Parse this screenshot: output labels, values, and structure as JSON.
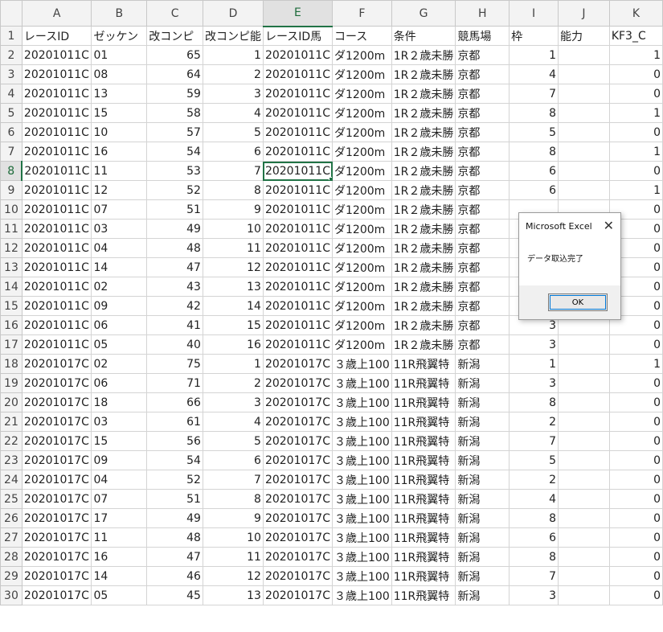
{
  "columns": [
    "A",
    "B",
    "C",
    "D",
    "E",
    "F",
    "G",
    "H",
    "I",
    "J",
    "K"
  ],
  "selected_column": "E",
  "selected_row": "8",
  "active_cell": "E8",
  "header_row": [
    "レースID",
    "ゼッケン",
    "改コンピ",
    "改コンピ能",
    "レースID馬",
    "コース",
    "条件",
    "競馬場",
    "枠",
    "能力",
    "KF3_C"
  ],
  "rows": [
    {
      "n": "2",
      "c": [
        "20201011C",
        "01",
        "65",
        "1",
        "20201011C",
        "ダ1200m",
        "1R２歳未勝",
        "京都",
        "1",
        "",
        "1"
      ]
    },
    {
      "n": "3",
      "c": [
        "20201011C",
        "08",
        "64",
        "2",
        "20201011C",
        "ダ1200m",
        "1R２歳未勝",
        "京都",
        "4",
        "",
        "0"
      ]
    },
    {
      "n": "4",
      "c": [
        "20201011C",
        "13",
        "59",
        "3",
        "20201011C",
        "ダ1200m",
        "1R２歳未勝",
        "京都",
        "7",
        "",
        "0"
      ]
    },
    {
      "n": "5",
      "c": [
        "20201011C",
        "15",
        "58",
        "4",
        "20201011C",
        "ダ1200m",
        "1R２歳未勝",
        "京都",
        "8",
        "",
        "1"
      ]
    },
    {
      "n": "6",
      "c": [
        "20201011C",
        "10",
        "57",
        "5",
        "20201011C",
        "ダ1200m",
        "1R２歳未勝",
        "京都",
        "5",
        "",
        "0"
      ]
    },
    {
      "n": "7",
      "c": [
        "20201011C",
        "16",
        "54",
        "6",
        "20201011C",
        "ダ1200m",
        "1R２歳未勝",
        "京都",
        "8",
        "",
        "1"
      ]
    },
    {
      "n": "8",
      "c": [
        "20201011C",
        "11",
        "53",
        "7",
        "20201011C",
        "ダ1200m",
        "1R２歳未勝",
        "京都",
        "6",
        "",
        "0"
      ]
    },
    {
      "n": "9",
      "c": [
        "20201011C",
        "12",
        "52",
        "8",
        "20201011C",
        "ダ1200m",
        "1R２歳未勝",
        "京都",
        "6",
        "",
        "1"
      ]
    },
    {
      "n": "10",
      "c": [
        "20201011C",
        "07",
        "51",
        "9",
        "20201011C",
        "ダ1200m",
        "1R２歳未勝",
        "京都",
        "",
        "",
        "0"
      ]
    },
    {
      "n": "11",
      "c": [
        "20201011C",
        "03",
        "49",
        "10",
        "20201011C",
        "ダ1200m",
        "1R２歳未勝",
        "京都",
        "",
        "",
        "0"
      ]
    },
    {
      "n": "12",
      "c": [
        "20201011C",
        "04",
        "48",
        "11",
        "20201011C",
        "ダ1200m",
        "1R２歳未勝",
        "京都",
        "",
        "",
        "0"
      ]
    },
    {
      "n": "13",
      "c": [
        "20201011C",
        "14",
        "47",
        "12",
        "20201011C",
        "ダ1200m",
        "1R２歳未勝",
        "京都",
        "",
        "",
        "0"
      ]
    },
    {
      "n": "14",
      "c": [
        "20201011C",
        "02",
        "43",
        "13",
        "20201011C",
        "ダ1200m",
        "1R２歳未勝",
        "京都",
        "",
        "",
        "0"
      ]
    },
    {
      "n": "15",
      "c": [
        "20201011C",
        "09",
        "42",
        "14",
        "20201011C",
        "ダ1200m",
        "1R２歳未勝",
        "京都",
        "",
        "",
        "0"
      ]
    },
    {
      "n": "16",
      "c": [
        "20201011C",
        "06",
        "41",
        "15",
        "20201011C",
        "ダ1200m",
        "1R２歳未勝",
        "京都",
        "3",
        "",
        "0"
      ]
    },
    {
      "n": "17",
      "c": [
        "20201011C",
        "05",
        "40",
        "16",
        "20201011C",
        "ダ1200m",
        "1R２歳未勝",
        "京都",
        "3",
        "",
        "0"
      ]
    },
    {
      "n": "18",
      "c": [
        "20201017C",
        "02",
        "75",
        "1",
        "20201017C",
        "３歳上100",
        "11R飛翼特",
        "新潟",
        "1",
        "",
        "1"
      ]
    },
    {
      "n": "19",
      "c": [
        "20201017C",
        "06",
        "71",
        "2",
        "20201017C",
        "３歳上100",
        "11R飛翼特",
        "新潟",
        "3",
        "",
        "0"
      ]
    },
    {
      "n": "20",
      "c": [
        "20201017C",
        "18",
        "66",
        "3",
        "20201017C",
        "３歳上100",
        "11R飛翼特",
        "新潟",
        "8",
        "",
        "0"
      ]
    },
    {
      "n": "21",
      "c": [
        "20201017C",
        "03",
        "61",
        "4",
        "20201017C",
        "３歳上100",
        "11R飛翼特",
        "新潟",
        "2",
        "",
        "0"
      ]
    },
    {
      "n": "22",
      "c": [
        "20201017C",
        "15",
        "56",
        "5",
        "20201017C",
        "３歳上100",
        "11R飛翼特",
        "新潟",
        "7",
        "",
        "0"
      ]
    },
    {
      "n": "23",
      "c": [
        "20201017C",
        "09",
        "54",
        "6",
        "20201017C",
        "３歳上100",
        "11R飛翼特",
        "新潟",
        "5",
        "",
        "0"
      ]
    },
    {
      "n": "24",
      "c": [
        "20201017C",
        "04",
        "52",
        "7",
        "20201017C",
        "３歳上100",
        "11R飛翼特",
        "新潟",
        "2",
        "",
        "0"
      ]
    },
    {
      "n": "25",
      "c": [
        "20201017C",
        "07",
        "51",
        "8",
        "20201017C",
        "３歳上100",
        "11R飛翼特",
        "新潟",
        "4",
        "",
        "0"
      ]
    },
    {
      "n": "26",
      "c": [
        "20201017C",
        "17",
        "49",
        "9",
        "20201017C",
        "３歳上100",
        "11R飛翼特",
        "新潟",
        "8",
        "",
        "0"
      ]
    },
    {
      "n": "27",
      "c": [
        "20201017C",
        "11",
        "48",
        "10",
        "20201017C",
        "３歳上100",
        "11R飛翼特",
        "新潟",
        "6",
        "",
        "0"
      ]
    },
    {
      "n": "28",
      "c": [
        "20201017C",
        "16",
        "47",
        "11",
        "20201017C",
        "３歳上100",
        "11R飛翼特",
        "新潟",
        "8",
        "",
        "0"
      ]
    },
    {
      "n": "29",
      "c": [
        "20201017C",
        "14",
        "46",
        "12",
        "20201017C",
        "３歳上100",
        "11R飛翼特",
        "新潟",
        "7",
        "",
        "0"
      ]
    },
    {
      "n": "30",
      "c": [
        "20201017C",
        "05",
        "45",
        "13",
        "20201017C",
        "３歳上100",
        "11R飛翼特",
        "新潟",
        "3",
        "",
        "0"
      ]
    }
  ],
  "dialog": {
    "title": "Microsoft Excel",
    "close_glyph": "✕",
    "message": "データ取込完了",
    "ok_label": "OK"
  },
  "colors": {
    "selection": "#217346",
    "header_bg": "#f3f3f3",
    "gridline": "#d4d4d4"
  }
}
